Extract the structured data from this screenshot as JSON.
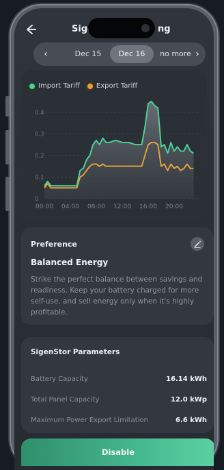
{
  "header": {
    "title_left": "Sigen",
    "title_right": "ng"
  },
  "date_nav": {
    "prev": "Dec 15",
    "current": "Dec 16",
    "next": "no more"
  },
  "legend": {
    "import_label": "Import Tariff",
    "export_label": "Export Tariff"
  },
  "colors": {
    "import": "#4fcf96",
    "export": "#e2a13a",
    "accent": "#46b88e"
  },
  "chart_data": {
    "type": "line",
    "xlabel": "",
    "ylabel": "",
    "ylim": [
      0,
      0.45
    ],
    "xlim": [
      0,
      24
    ],
    "x_ticks": [
      "00:00",
      "04:00",
      "08:00",
      "12:00",
      "16:00",
      "20:00"
    ],
    "x_tick_values": [
      0,
      4,
      8,
      12,
      16,
      20
    ],
    "y_ticks": [
      "0",
      "0.1",
      "0.2",
      "0.3",
      "0.4"
    ],
    "y_tick_values": [
      0,
      0.1,
      0.2,
      0.3,
      0.4
    ],
    "grid": true,
    "legend_position": "top-left",
    "series": [
      {
        "name": "Import Tariff",
        "x": [
          0,
          0.5,
          1,
          1.5,
          2,
          3,
          4,
          5,
          5.5,
          6,
          6.5,
          7,
          7.5,
          8,
          8.5,
          9,
          9.5,
          10,
          11,
          12,
          13,
          14,
          15,
          15.5,
          16,
          16.5,
          17,
          17.5,
          18,
          18.5,
          19,
          19.5,
          20,
          20.5,
          21,
          21.5,
          22,
          22.5,
          23
        ],
        "y": [
          0.06,
          0.08,
          0.06,
          0.06,
          0.06,
          0.06,
          0.06,
          0.06,
          0.13,
          0.14,
          0.18,
          0.2,
          0.25,
          0.27,
          0.25,
          0.28,
          0.26,
          0.26,
          0.27,
          0.26,
          0.26,
          0.25,
          0.25,
          0.33,
          0.44,
          0.45,
          0.43,
          0.42,
          0.24,
          0.25,
          0.21,
          0.26,
          0.22,
          0.24,
          0.22,
          0.22,
          0.25,
          0.22,
          0.21
        ]
      },
      {
        "name": "Export Tariff",
        "x": [
          0,
          0.5,
          1,
          1.5,
          2,
          3,
          4,
          5,
          5.5,
          6,
          6.5,
          7,
          7.5,
          8,
          8.5,
          9,
          9.5,
          10,
          11,
          12,
          13,
          14,
          15,
          15.5,
          16,
          16.5,
          17,
          17.5,
          18,
          18.5,
          19,
          19.5,
          20,
          20.5,
          21,
          21.5,
          22,
          22.5,
          23
        ],
        "y": [
          0.05,
          0.07,
          0.05,
          0.05,
          0.05,
          0.05,
          0.05,
          0.05,
          0.1,
          0.11,
          0.13,
          0.15,
          0.16,
          0.16,
          0.15,
          0.16,
          0.15,
          0.15,
          0.15,
          0.15,
          0.15,
          0.15,
          0.15,
          0.2,
          0.25,
          0.26,
          0.26,
          0.25,
          0.15,
          0.16,
          0.13,
          0.16,
          0.14,
          0.15,
          0.13,
          0.14,
          0.16,
          0.14,
          0.14
        ]
      }
    ]
  },
  "preference": {
    "label": "Preference",
    "mode": "Balanced Energy",
    "description": "Strike the perfect balance between savings and readiness. Keep your battery charged for more self-use, and sell energy only when it's highly profitable."
  },
  "parameters": {
    "title": "SigenStor Parameters",
    "rows": [
      {
        "label": "Battery Capacity",
        "value": "16.14 kWh"
      },
      {
        "label": "Total Panel Capacity",
        "value": "12.0 kWp"
      },
      {
        "label": "Maximum Power Export Limitation",
        "value": "6.6 kWh"
      }
    ]
  },
  "actions": {
    "disable_label": "Disable"
  }
}
